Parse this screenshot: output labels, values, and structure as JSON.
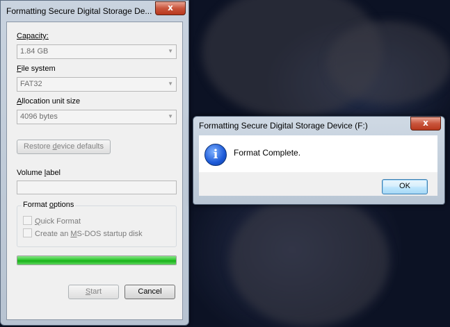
{
  "main_window": {
    "title": "Formatting Secure Digital Storage De...",
    "close_label": "x",
    "capacity": {
      "label": "Capacity:",
      "value": "1.84 GB"
    },
    "file_system": {
      "label_prefix": "",
      "label_ul": "F",
      "label_rest": "ile system",
      "value": "FAT32"
    },
    "allocation": {
      "label_ul": "A",
      "label_rest": "llocation unit size",
      "value": "4096 bytes"
    },
    "restore_button": {
      "pre": "Restore ",
      "ul": "d",
      "post": "evice defaults"
    },
    "volume_label": {
      "pre": "Volume ",
      "ul": "l",
      "post": "abel",
      "value": ""
    },
    "format_options": {
      "legend_pre": "Format ",
      "legend_ul": "o",
      "legend_post": "ptions",
      "quick_format": {
        "ul": "Q",
        "rest": "uick Format"
      },
      "msdos_disk": {
        "pre": "Create an ",
        "ul": "M",
        "post": "S-DOS startup disk"
      }
    },
    "progress": 1.0,
    "start_button": {
      "ul": "S",
      "rest": "tart"
    },
    "cancel_button": "Cancel"
  },
  "dialog": {
    "title": "Formatting Secure Digital Storage Device (F:)",
    "close_label": "x",
    "icon": "info-icon",
    "icon_glyph": "i",
    "message": "Format Complete.",
    "ok_button": "OK"
  },
  "colors": {
    "progress_fill": "#2fc82f",
    "close_button": "#c9553c",
    "ok_border": "#3c7fb1"
  }
}
